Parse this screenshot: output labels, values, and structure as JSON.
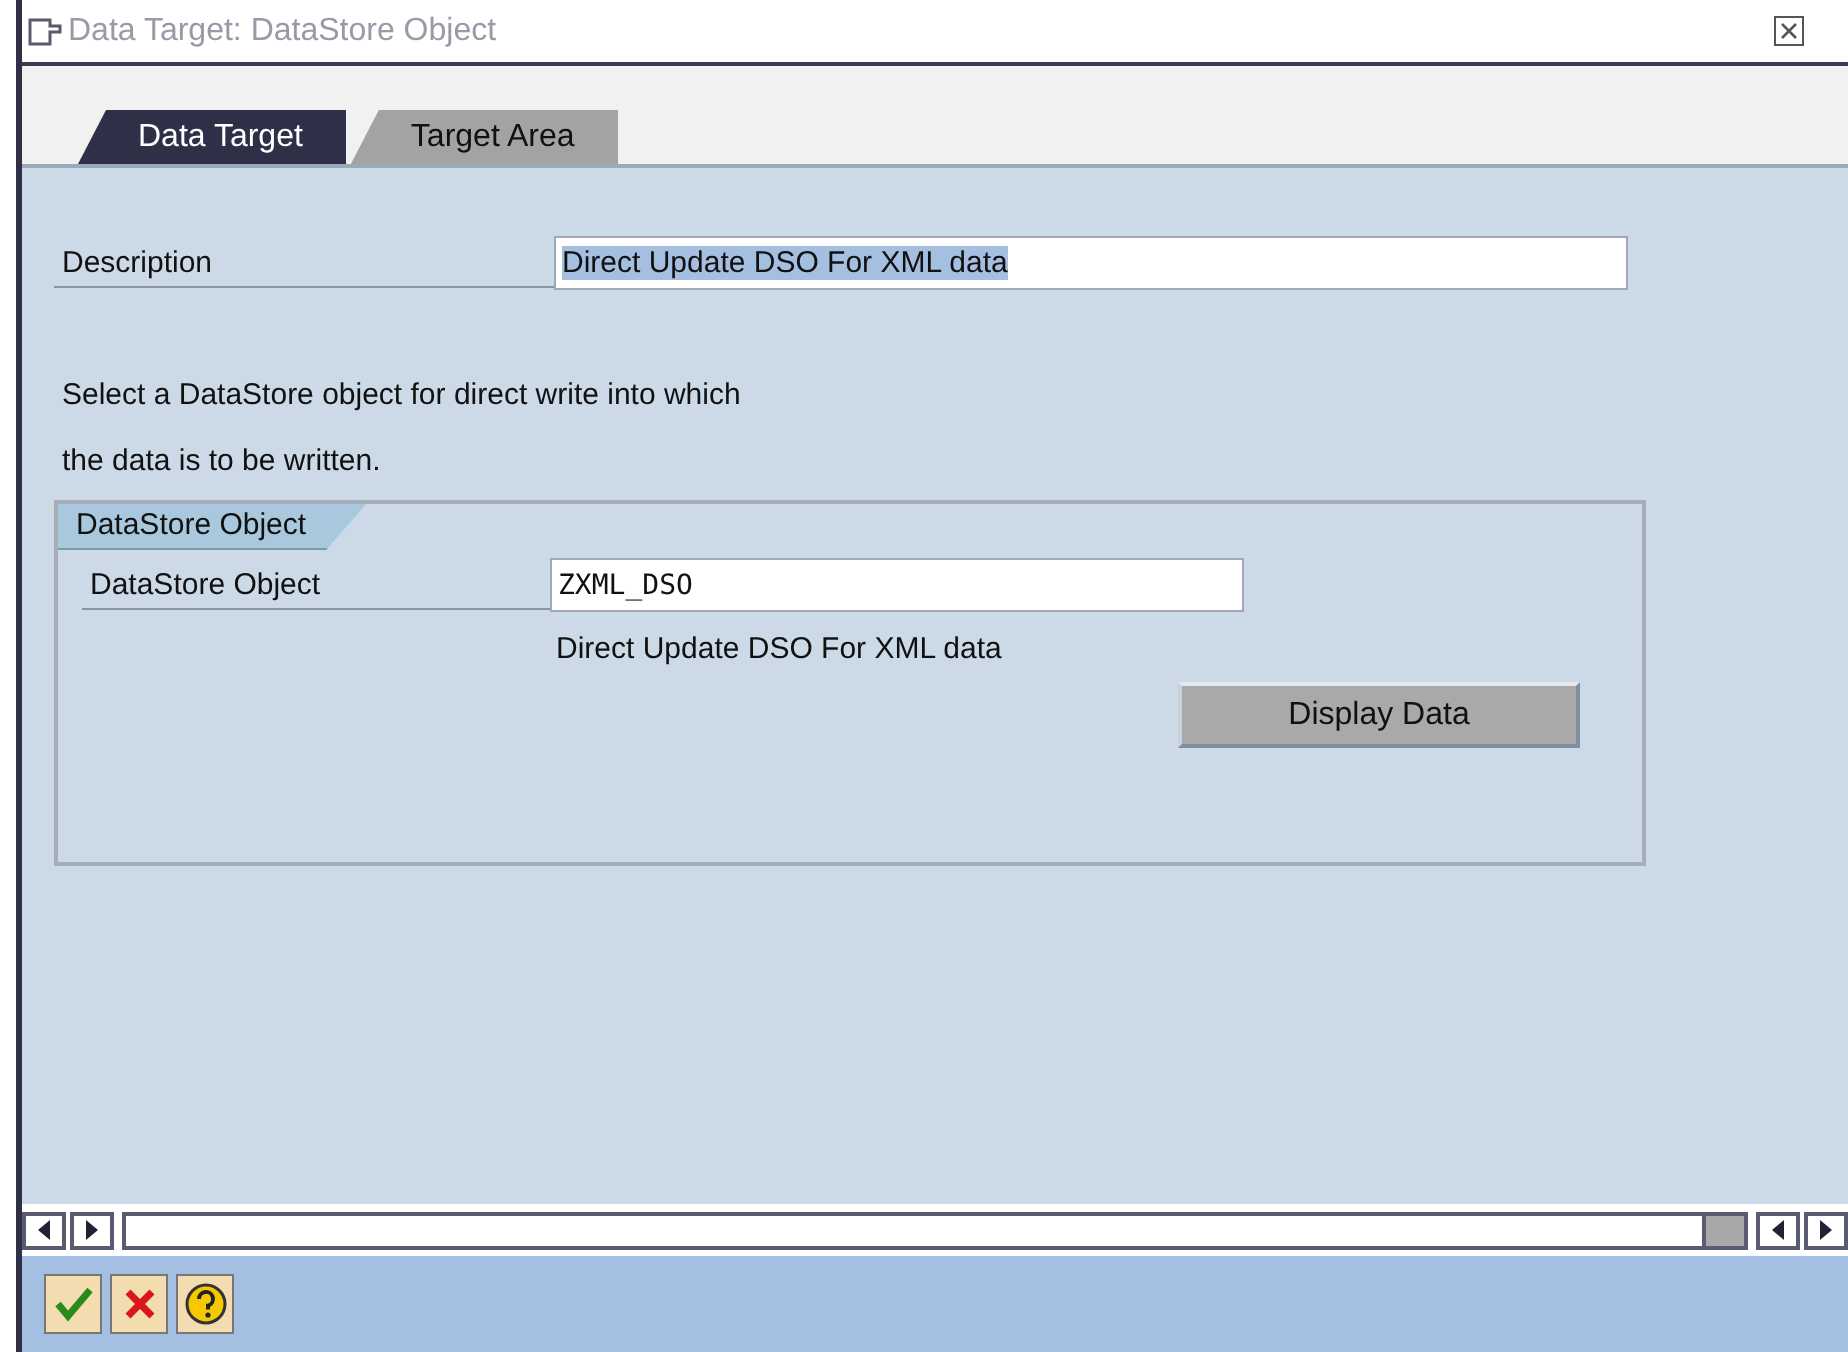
{
  "window": {
    "title": "Data Target: DataStore Object"
  },
  "tabs": [
    {
      "label": "Data Target",
      "selected": true
    },
    {
      "label": "Target Area",
      "selected": false
    }
  ],
  "description": {
    "label": "Description",
    "value": "Direct Update DSO For XML data",
    "highlighted": true
  },
  "instruction": [
    "Select a DataStore object for direct write into which",
    "the data is to be written."
  ],
  "group": {
    "title": "DataStore Object",
    "field_label": "DataStore Object",
    "value": "ZXML_DSO",
    "value_description": "Direct Update DSO For XML data",
    "button": "Display Data"
  },
  "footer_buttons": [
    {
      "kind": "confirm"
    },
    {
      "kind": "cancel"
    },
    {
      "kind": "help"
    }
  ]
}
